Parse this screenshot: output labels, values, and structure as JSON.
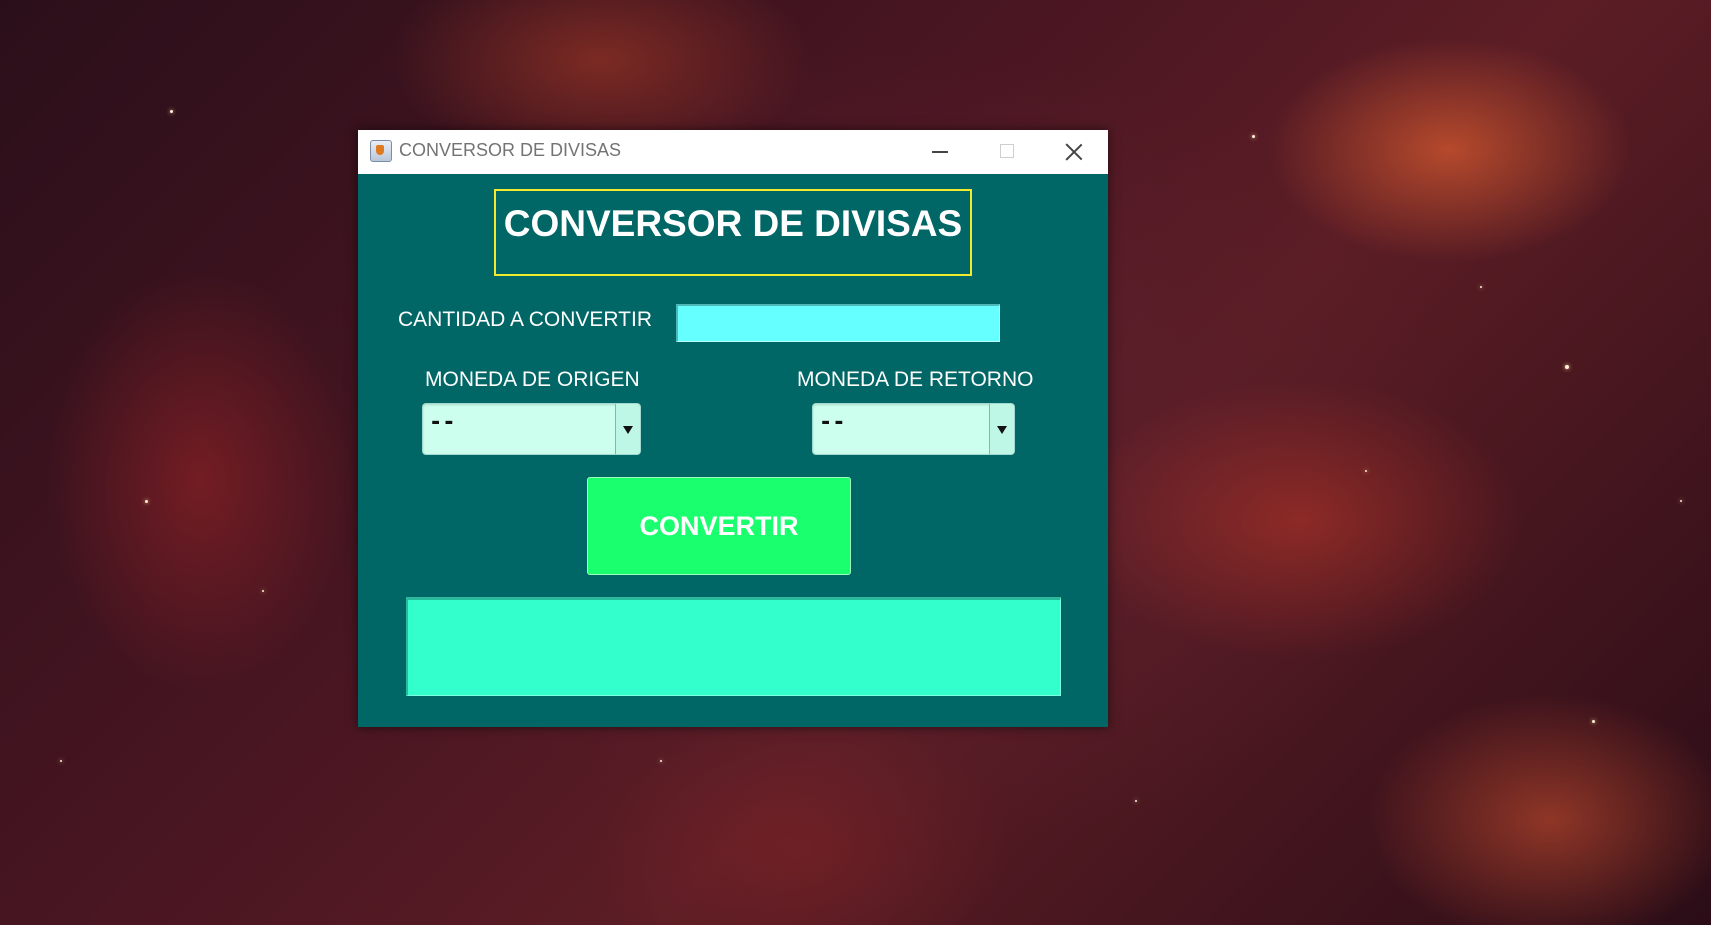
{
  "window": {
    "title": "CONVERSOR DE DIVISAS",
    "app_icon": "java-cup-icon",
    "controls": [
      "minimize-icon",
      "maximize-icon",
      "close-icon"
    ]
  },
  "main": {
    "heading": "CONVERSOR DE DIVISAS",
    "amount_label": "CANTIDAD A CONVERTIR",
    "amount_value": "",
    "origin_label": "MONEDA DE ORIGEN",
    "origin_selected": "--",
    "target_label": "MONEDA DE RETORNO",
    "target_selected": "--",
    "convert_label": "CONVERTIR",
    "result_text": ""
  },
  "colors": {
    "panel_bg": "#006666",
    "heading_border": "#f2ea2e",
    "amount_input_bg": "#66ffff",
    "select_bg": "#ccffee",
    "convert_button_bg": "#1aff6e",
    "result_bg": "#33ffcc"
  }
}
